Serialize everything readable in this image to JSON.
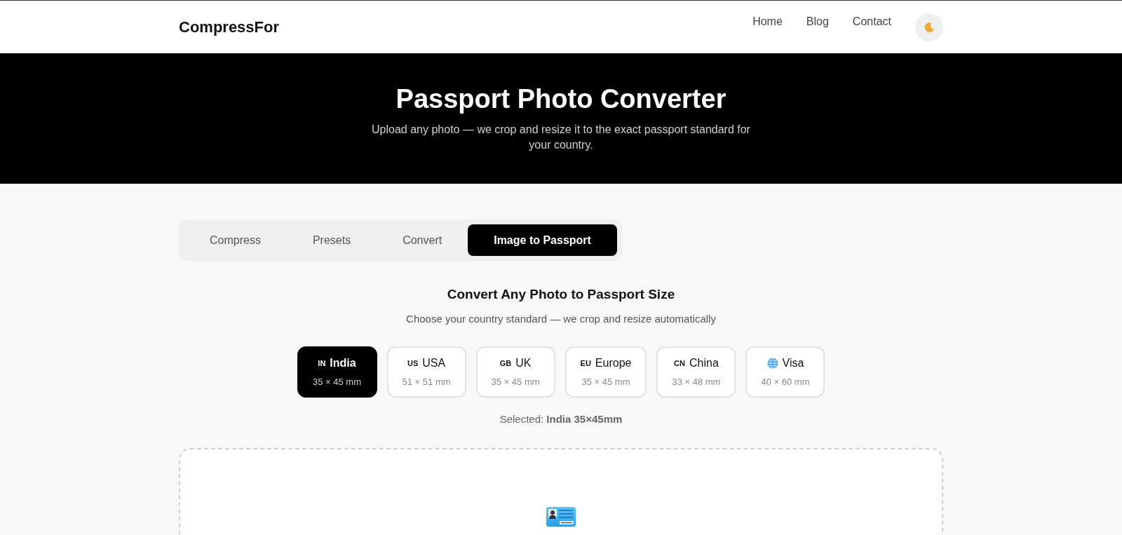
{
  "header": {
    "logo": "CompressFor",
    "nav": [
      "Home",
      "Blog",
      "Contact"
    ]
  },
  "hero": {
    "title": "Passport Photo Converter",
    "subtitle": "Upload any photo — we crop and resize it to the exact passport standard for your country."
  },
  "tabs": [
    {
      "label": "Compress",
      "selected": false
    },
    {
      "label": "Presets",
      "selected": false
    },
    {
      "label": "Convert",
      "selected": false
    },
    {
      "label": "Image to Passport",
      "selected": true
    }
  ],
  "converter": {
    "heading": "Convert Any Photo to Passport Size",
    "subheading": "Choose your country standard — we crop and resize automatically",
    "countries": [
      {
        "kind": "code",
        "code": "IN",
        "name": "India",
        "size": "35 × 45 mm",
        "selected": true
      },
      {
        "kind": "code",
        "code": "US",
        "name": "USA",
        "size": "51 × 51 mm",
        "selected": false
      },
      {
        "kind": "code",
        "code": "GB",
        "name": "UK",
        "size": "35 × 45 mm",
        "selected": false
      },
      {
        "kind": "code",
        "code": "EU",
        "name": "Europe",
        "size": "35 × 45 mm",
        "selected": false
      },
      {
        "kind": "code",
        "code": "CN",
        "name": "China",
        "size": "33 × 48 mm",
        "selected": false
      },
      {
        "kind": "globe",
        "name": "Visa",
        "size": "40 × 60 mm",
        "selected": false
      }
    ],
    "selection": "Selected: **India 35×45mm**"
  }
}
